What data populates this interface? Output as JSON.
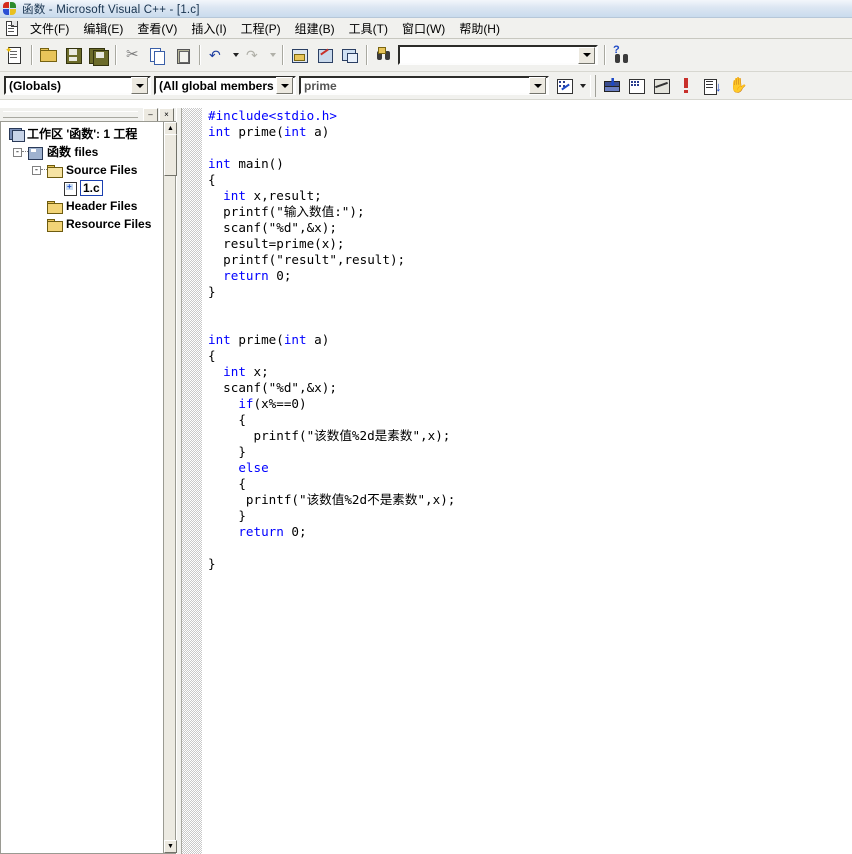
{
  "window": {
    "title": "函数 - Microsoft Visual C++ - [1.c]",
    "app_icon": "vcpp-logo-icon"
  },
  "menubar": {
    "doc_icon": "document-icon",
    "items": [
      {
        "label": "文件(F)",
        "name": "menu-file"
      },
      {
        "label": "编辑(E)",
        "name": "menu-edit"
      },
      {
        "label": "查看(V)",
        "name": "menu-view"
      },
      {
        "label": "插入(I)",
        "name": "menu-insert"
      },
      {
        "label": "工程(P)",
        "name": "menu-project"
      },
      {
        "label": "组建(B)",
        "name": "menu-build"
      },
      {
        "label": "工具(T)",
        "name": "menu-tools"
      },
      {
        "label": "窗口(W)",
        "name": "menu-window"
      },
      {
        "label": "帮助(H)",
        "name": "menu-help"
      }
    ]
  },
  "toolbar_standard": {
    "buttons": [
      {
        "name": "new-file-icon"
      },
      {
        "name": "open-file-icon"
      },
      {
        "name": "save-icon"
      },
      {
        "name": "save-all-icon"
      },
      {
        "name": "cut-icon"
      },
      {
        "name": "copy-icon"
      },
      {
        "name": "paste-icon"
      },
      {
        "name": "undo-icon"
      },
      {
        "name": "undo-dropdown-icon"
      },
      {
        "name": "redo-icon"
      },
      {
        "name": "redo-dropdown-icon"
      },
      {
        "name": "workspace-window-icon"
      },
      {
        "name": "output-window-icon"
      },
      {
        "name": "window-list-icon"
      },
      {
        "name": "find-in-files-icon"
      },
      {
        "name": "search-help-icon"
      }
    ],
    "find_combo": {
      "value": "",
      "placeholder": "",
      "name": "find-combo"
    }
  },
  "toolbar_build": {
    "buttons": [
      {
        "name": "compile-icon"
      },
      {
        "name": "build-icon"
      },
      {
        "name": "stop-build-icon"
      },
      {
        "name": "execute-program-icon"
      },
      {
        "name": "go-icon"
      },
      {
        "name": "insert-breakpoint-icon"
      }
    ]
  },
  "toolbar_wizardbar": {
    "class_combo": {
      "value": "(Globals)",
      "name": "class-combo"
    },
    "filter_combo": {
      "value": "(All global members",
      "name": "members-combo"
    },
    "function_combo": {
      "value": "prime",
      "name": "function-combo"
    },
    "action_icon": "wizardbar-action-icon",
    "action_dropdown_icon": "wizardbar-dropdown-icon"
  },
  "workspace": {
    "caption": {
      "minimize_label": "–",
      "close_label": "×"
    },
    "tree": [
      {
        "label": "工作区 '函数': 1 工程",
        "name": "tree-workspace-root",
        "icon": "workspace-icon",
        "depth": 0,
        "expander": null,
        "selected": false
      },
      {
        "label": "函数 files",
        "name": "tree-project-files",
        "icon": "project-icon",
        "depth": 1,
        "expander": "-",
        "selected": false
      },
      {
        "label": "Source Files",
        "name": "tree-source-files",
        "icon": "folder-open-icon",
        "depth": 2,
        "expander": "-",
        "selected": false
      },
      {
        "label": "1.c",
        "name": "tree-file-1c",
        "icon": "c-file-icon",
        "depth": 3,
        "expander": null,
        "selected": true
      },
      {
        "label": "Header Files",
        "name": "tree-header-files",
        "icon": "folder-icon",
        "depth": 2,
        "expander": null,
        "selected": false
      },
      {
        "label": "Resource Files",
        "name": "tree-resource-files",
        "icon": "folder-icon",
        "depth": 2,
        "expander": null,
        "selected": false
      }
    ]
  },
  "editor": {
    "filename": "1.c",
    "lines": [
      [
        {
          "t": "#include<stdio.h>",
          "c": "pp"
        }
      ],
      [
        {
          "t": "int",
          "c": "kw"
        },
        {
          "t": " prime(",
          "c": ""
        },
        {
          "t": "int",
          "c": "kw"
        },
        {
          "t": " a)",
          "c": ""
        }
      ],
      [],
      [
        {
          "t": "int",
          "c": "kw"
        },
        {
          "t": " main()",
          "c": ""
        }
      ],
      [
        {
          "t": "{",
          "c": ""
        }
      ],
      [
        {
          "t": "  ",
          "c": ""
        },
        {
          "t": "int",
          "c": "kw"
        },
        {
          "t": " x,result;",
          "c": ""
        }
      ],
      [
        {
          "t": "  printf(\"输入数值:\");",
          "c": ""
        }
      ],
      [
        {
          "t": "  scanf(\"%d\",&x);",
          "c": ""
        }
      ],
      [
        {
          "t": "  result=prime(x);",
          "c": ""
        }
      ],
      [
        {
          "t": "  printf(\"result\",result);",
          "c": ""
        }
      ],
      [
        {
          "t": "  ",
          "c": ""
        },
        {
          "t": "return",
          "c": "kw"
        },
        {
          "t": " 0;",
          "c": ""
        }
      ],
      [
        {
          "t": "}",
          "c": ""
        }
      ],
      [],
      [],
      [
        {
          "t": "int",
          "c": "kw"
        },
        {
          "t": " prime(",
          "c": ""
        },
        {
          "t": "int",
          "c": "kw"
        },
        {
          "t": " a)",
          "c": ""
        }
      ],
      [
        {
          "t": "{",
          "c": ""
        }
      ],
      [
        {
          "t": "  ",
          "c": ""
        },
        {
          "t": "int",
          "c": "kw"
        },
        {
          "t": " x;",
          "c": ""
        }
      ],
      [
        {
          "t": "  scanf(\"%d\",&x);",
          "c": ""
        }
      ],
      [
        {
          "t": "    ",
          "c": ""
        },
        {
          "t": "if",
          "c": "kw"
        },
        {
          "t": "(x%==0)",
          "c": ""
        }
      ],
      [
        {
          "t": "    {",
          "c": ""
        }
      ],
      [
        {
          "t": "      printf(\"该数值%2d是素数\",x);",
          "c": ""
        }
      ],
      [
        {
          "t": "    }",
          "c": ""
        }
      ],
      [
        {
          "t": "    ",
          "c": ""
        },
        {
          "t": "else",
          "c": "kw"
        },
        {
          "t": "",
          "c": ""
        }
      ],
      [
        {
          "t": "    {",
          "c": ""
        }
      ],
      [
        {
          "t": "     printf(\"该数值%2d不是素数\",x);",
          "c": ""
        }
      ],
      [
        {
          "t": "    }",
          "c": ""
        }
      ],
      [
        {
          "t": "    ",
          "c": ""
        },
        {
          "t": "return",
          "c": "kw"
        },
        {
          "t": " 0;",
          "c": ""
        }
      ],
      [],
      [
        {
          "t": "}",
          "c": ""
        }
      ]
    ]
  },
  "colors": {
    "keyword": "#0000ff",
    "text": "#000000",
    "titlebar_start": "#f2f6fb",
    "titlebar_end": "#c9dbed",
    "chrome": "#f1f1ee",
    "selection_border": "#1a3fb0"
  }
}
